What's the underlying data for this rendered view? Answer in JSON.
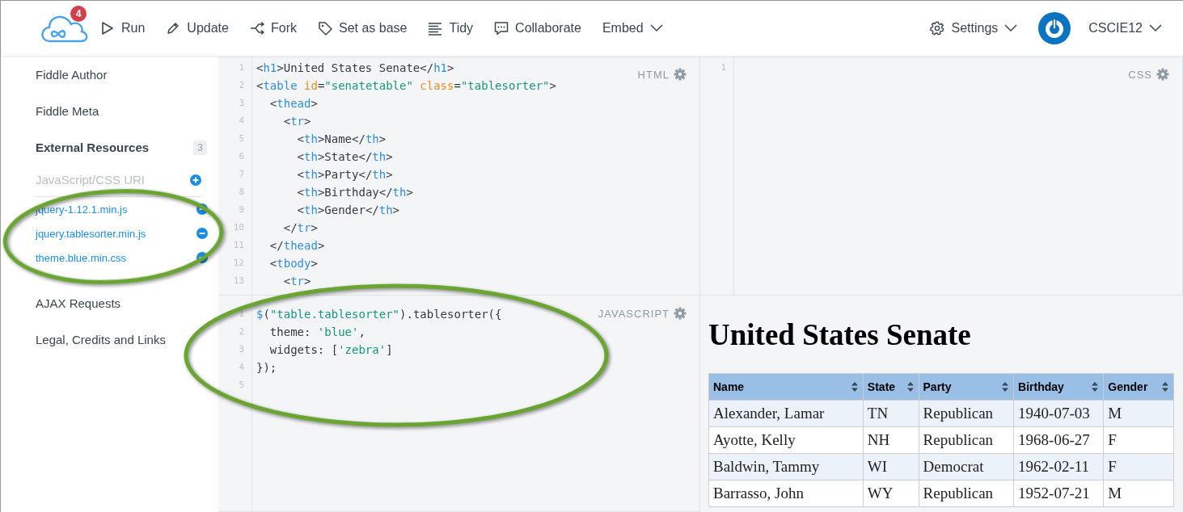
{
  "toolbar": {
    "logo_badge": "4",
    "actions": [
      {
        "label": "Run",
        "has_menu": false
      },
      {
        "label": "Update",
        "has_menu": false
      },
      {
        "label": "Fork",
        "has_menu": false
      },
      {
        "label": "Set as base",
        "has_menu": false
      },
      {
        "label": "Tidy",
        "has_menu": false
      },
      {
        "label": "Collaborate",
        "has_menu": false
      },
      {
        "label": "Embed",
        "has_menu": true
      }
    ],
    "settings": {
      "label": "Settings"
    },
    "user": {
      "name": "CSCIE12"
    }
  },
  "sidebar": {
    "items": [
      {
        "label": "Fiddle Author",
        "expanded": false
      },
      {
        "label": "Fiddle Meta",
        "expanded": false
      },
      {
        "label": "External Resources",
        "expanded": true,
        "count": "3",
        "uri_placeholder": "JavaScript/CSS URI",
        "resources": [
          "jquery-1.12.1.min.js",
          "jquery.tablesorter.min.js",
          "theme.blue.min.css"
        ]
      },
      {
        "label": "AJAX Requests",
        "expanded": false
      },
      {
        "label": "Legal, Credits and Links",
        "expanded": false
      }
    ]
  },
  "panels": {
    "html": {
      "label": "HTML",
      "lines": [
        {
          "number": "1",
          "tokens": [
            {
              "kind": "plain",
              "text": "<"
            },
            {
              "kind": "tag",
              "text": "h1"
            },
            {
              "kind": "plain",
              "text": ">United States Senate</"
            },
            {
              "kind": "tag",
              "text": "h1"
            },
            {
              "kind": "plain",
              "text": ">"
            }
          ]
        },
        {
          "number": "2",
          "tokens": [
            {
              "kind": "plain",
              "text": "<"
            },
            {
              "kind": "tag",
              "text": "table"
            },
            {
              "kind": "attr",
              "text": " id"
            },
            {
              "kind": "plain",
              "text": "="
            },
            {
              "kind": "string",
              "text": "\"senatetable\""
            },
            {
              "kind": "attr",
              "text": " class"
            },
            {
              "kind": "plain",
              "text": "="
            },
            {
              "kind": "string",
              "text": "\"tablesorter\""
            },
            {
              "kind": "plain",
              "text": ">"
            }
          ]
        },
        {
          "number": "3",
          "tokens": [
            {
              "kind": "plain",
              "text": "  <"
            },
            {
              "kind": "tag",
              "text": "thead"
            },
            {
              "kind": "plain",
              "text": ">"
            }
          ]
        },
        {
          "number": "4",
          "tokens": [
            {
              "kind": "plain",
              "text": "    <"
            },
            {
              "kind": "tag",
              "text": "tr"
            },
            {
              "kind": "plain",
              "text": ">"
            }
          ]
        },
        {
          "number": "5",
          "tokens": [
            {
              "kind": "plain",
              "text": "      <"
            },
            {
              "kind": "tag",
              "text": "th"
            },
            {
              "kind": "plain",
              "text": ">Name</"
            },
            {
              "kind": "tag",
              "text": "th"
            },
            {
              "kind": "plain",
              "text": ">"
            }
          ]
        },
        {
          "number": "6",
          "tokens": [
            {
              "kind": "plain",
              "text": "      <"
            },
            {
              "kind": "tag",
              "text": "th"
            },
            {
              "kind": "plain",
              "text": ">State</"
            },
            {
              "kind": "tag",
              "text": "th"
            },
            {
              "kind": "plain",
              "text": ">"
            }
          ]
        },
        {
          "number": "7",
          "tokens": [
            {
              "kind": "plain",
              "text": "      <"
            },
            {
              "kind": "tag",
              "text": "th"
            },
            {
              "kind": "plain",
              "text": ">Party</"
            },
            {
              "kind": "tag",
              "text": "th"
            },
            {
              "kind": "plain",
              "text": ">"
            }
          ]
        },
        {
          "number": "8",
          "tokens": [
            {
              "kind": "plain",
              "text": "      <"
            },
            {
              "kind": "tag",
              "text": "th"
            },
            {
              "kind": "plain",
              "text": ">Birthday</"
            },
            {
              "kind": "tag",
              "text": "th"
            },
            {
              "kind": "plain",
              "text": ">"
            }
          ]
        },
        {
          "number": "9",
          "tokens": [
            {
              "kind": "plain",
              "text": "      <"
            },
            {
              "kind": "tag",
              "text": "th"
            },
            {
              "kind": "plain",
              "text": ">Gender</"
            },
            {
              "kind": "tag",
              "text": "th"
            },
            {
              "kind": "plain",
              "text": ">"
            }
          ]
        },
        {
          "number": "10",
          "tokens": [
            {
              "kind": "plain",
              "text": "    </"
            },
            {
              "kind": "tag",
              "text": "tr"
            },
            {
              "kind": "plain",
              "text": ">"
            }
          ]
        },
        {
          "number": "11",
          "tokens": [
            {
              "kind": "plain",
              "text": "  </"
            },
            {
              "kind": "tag",
              "text": "thead"
            },
            {
              "kind": "plain",
              "text": ">"
            }
          ]
        },
        {
          "number": "12",
          "tokens": [
            {
              "kind": "plain",
              "text": "  <"
            },
            {
              "kind": "tag",
              "text": "tbody"
            },
            {
              "kind": "plain",
              "text": ">"
            }
          ]
        },
        {
          "number": "13",
          "tokens": [
            {
              "kind": "plain",
              "text": "    <"
            },
            {
              "kind": "tag",
              "text": "tr"
            },
            {
              "kind": "plain",
              "text": ">"
            }
          ]
        }
      ]
    },
    "css": {
      "label": "CSS",
      "lines": [
        {
          "number": "1"
        }
      ]
    },
    "javascript": {
      "label": "JAVASCRIPT",
      "lines": [
        {
          "number": "1",
          "tokens": [
            {
              "kind": "tag",
              "text": "$"
            },
            {
              "kind": "plain",
              "text": "("
            },
            {
              "kind": "string",
              "text": "\"table.tablesorter\""
            },
            {
              "kind": "plain",
              "text": ").tablesorter({"
            }
          ]
        },
        {
          "number": "2",
          "tokens": [
            {
              "kind": "plain",
              "text": "  theme: "
            },
            {
              "kind": "string",
              "text": "'blue'"
            },
            {
              "kind": "plain",
              "text": ","
            }
          ]
        },
        {
          "number": "3",
          "tokens": [
            {
              "kind": "plain",
              "text": "  widgets: ["
            },
            {
              "kind": "string",
              "text": "'zebra'"
            },
            {
              "kind": "plain",
              "text": "]"
            }
          ]
        },
        {
          "number": "4",
          "tokens": [
            {
              "kind": "plain",
              "text": "});"
            }
          ]
        },
        {
          "number": "5"
        }
      ]
    }
  },
  "result": {
    "heading": "United States Senate",
    "table": {
      "columns": [
        "Name",
        "State",
        "Party",
        "Birthday",
        "Gender"
      ],
      "rows": [
        [
          "Alexander, Lamar",
          "TN",
          "Republican",
          "1940-07-03",
          "M"
        ],
        [
          "Ayotte, Kelly",
          "NH",
          "Republican",
          "1968-06-27",
          "F"
        ],
        [
          "Baldwin, Tammy",
          "WI",
          "Democrat",
          "1962-02-11",
          "F"
        ],
        [
          "Barrasso, John",
          "WY",
          "Republican",
          "1952-07-21",
          "M"
        ]
      ]
    }
  }
}
